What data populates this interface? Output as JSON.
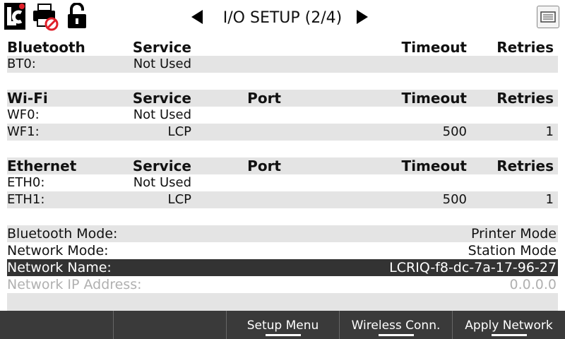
{
  "header": {
    "title": "I/O SETUP (2/4)",
    "icons": [
      "app-logo-icon",
      "printer-disabled-icon",
      "unlocked-padlock-icon",
      "network-port-icon"
    ]
  },
  "bluetooth": {
    "header": {
      "label": "Bluetooth",
      "service": "Service",
      "timeout": "Timeout",
      "retries": "Retries"
    },
    "rows": [
      {
        "label": "BT0:",
        "service": "Not Used",
        "timeout": "",
        "retries": ""
      }
    ]
  },
  "wifi": {
    "header": {
      "label": "Wi-Fi",
      "service": "Service",
      "port": "Port",
      "timeout": "Timeout",
      "retries": "Retries"
    },
    "rows": [
      {
        "label": "WF0:",
        "service": "Not Used",
        "port": "",
        "timeout": "",
        "retries": ""
      },
      {
        "label": "WF1:",
        "service": "LCP",
        "port": "",
        "timeout": "500",
        "retries": "1"
      }
    ]
  },
  "ethernet": {
    "header": {
      "label": "Ethernet",
      "service": "Service",
      "port": "Port",
      "timeout": "Timeout",
      "retries": "Retries"
    },
    "rows": [
      {
        "label": "ETH0:",
        "service": "Not Used",
        "port": "",
        "timeout": "",
        "retries": ""
      },
      {
        "label": "ETH1:",
        "service": "LCP",
        "port": "",
        "timeout": "500",
        "retries": "1"
      }
    ]
  },
  "settings": [
    {
      "label": "Bluetooth Mode:",
      "value": "Printer Mode"
    },
    {
      "label": "Network Mode:",
      "value": "Station Mode"
    },
    {
      "label": "Network Name:",
      "value": "LCRIQ-f8-dc-7a-17-96-27"
    },
    {
      "label": "Network IP Address:",
      "value": "0.0.0.0"
    }
  ],
  "footer": {
    "buttons": [
      "",
      "",
      "Setup Menu",
      "Wireless Conn.",
      "Apply Network"
    ]
  },
  "colors": {
    "selected_row": "#333333",
    "footer": "#3a3a3a",
    "stripe": "#e4e4e4",
    "disabled_text": "#b0b0b0",
    "alert_red": "#e0202a"
  }
}
